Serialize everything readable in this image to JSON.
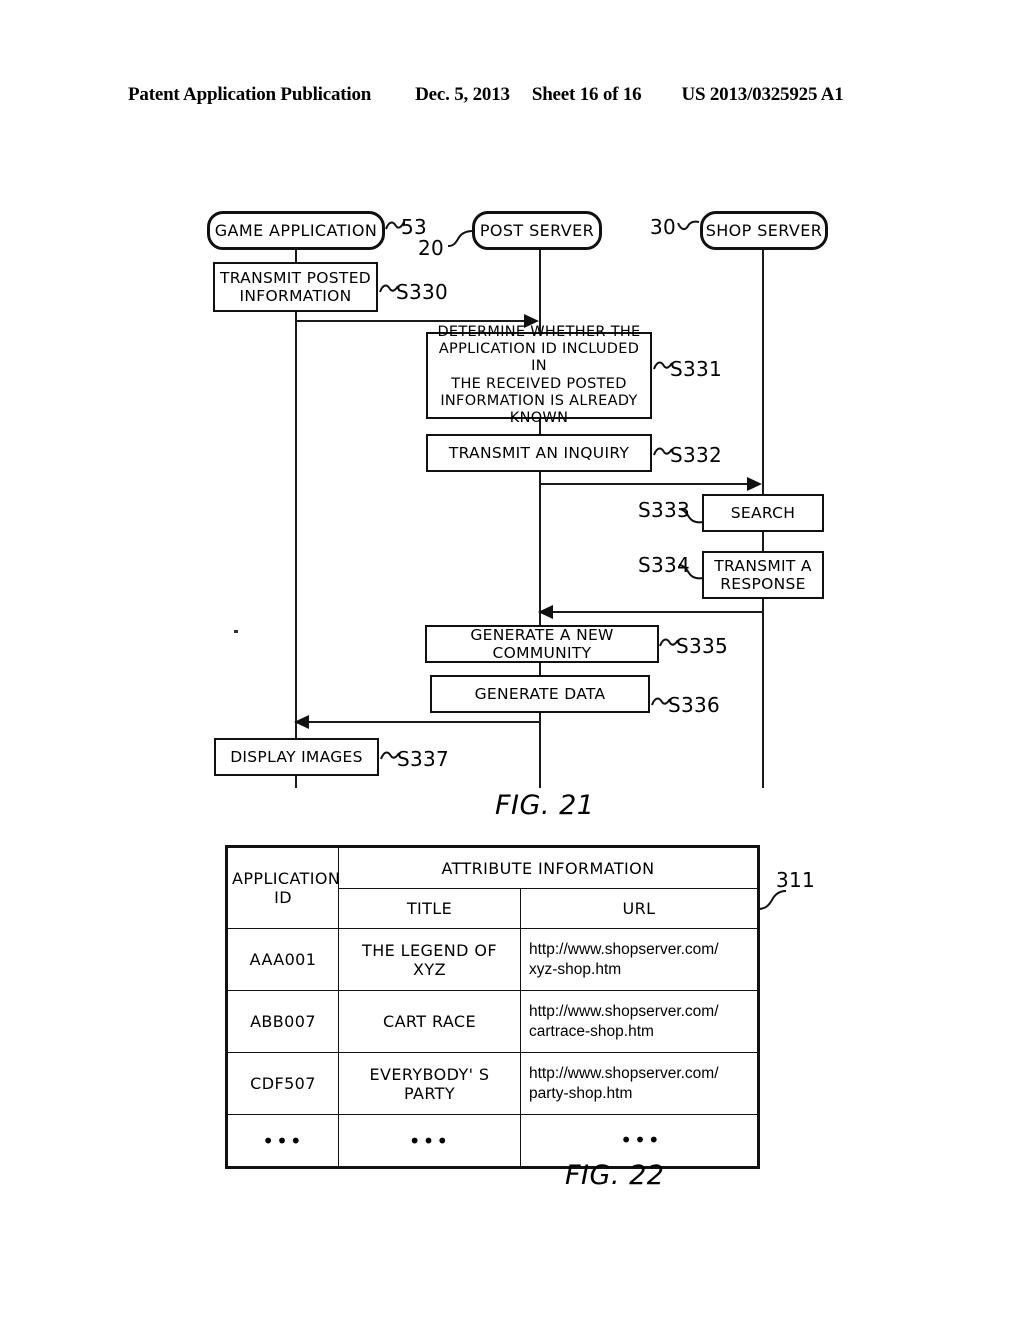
{
  "header": {
    "publication": "Patent Application Publication",
    "date": "Dec. 5, 2013",
    "sheet": "Sheet 16 of 16",
    "patent_number": "US 2013/0325925 A1"
  },
  "fig21": {
    "label": "FIG. 21",
    "actors": [
      {
        "name": "GAME APPLICATION",
        "ref": "53"
      },
      {
        "name": "POST SERVER",
        "ref": "20"
      },
      {
        "name": "SHOP SERVER",
        "ref": "30"
      }
    ],
    "steps": [
      {
        "id": "S330",
        "label": "TRANSMIT POSTED\nINFORMATION",
        "lane": "game-application"
      },
      {
        "id": "S331",
        "label": "DETERMINE WHETHER THE\nAPPLICATION ID INCLUDED IN\nTHE RECEIVED POSTED\nINFORMATION IS ALREADY KNOWN",
        "lane": "post-server"
      },
      {
        "id": "S332",
        "label": "TRANSMIT AN INQUIRY",
        "lane": "post-server"
      },
      {
        "id": "S333",
        "label": "SEARCH",
        "lane": "shop-server"
      },
      {
        "id": "S334",
        "label": "TRANSMIT A\nRESPONSE",
        "lane": "shop-server"
      },
      {
        "id": "S335",
        "label": "GENERATE A NEW COMMUNITY",
        "lane": "post-server"
      },
      {
        "id": "S336",
        "label": "GENERATE DATA",
        "lane": "post-server"
      },
      {
        "id": "S337",
        "label": "DISPLAY IMAGES",
        "lane": "game-application"
      }
    ],
    "step_labels": {
      "s330_box_l1": "TRANSMIT POSTED",
      "s330_box_l2": "INFORMATION",
      "s331_box_l1": "DETERMINE WHETHER THE",
      "s331_box_l2": "APPLICATION ID INCLUDED IN",
      "s331_box_l3": "THE RECEIVED POSTED",
      "s331_box_l4": "INFORMATION IS ALREADY KNOWN",
      "s332_box": "TRANSMIT AN INQUIRY",
      "s333_box": "SEARCH",
      "s334_box_l1": "TRANSMIT A",
      "s334_box_l2": "RESPONSE",
      "s335_box": "GENERATE A NEW COMMUNITY",
      "s336_box": "GENERATE DATA",
      "s337_box": "DISPLAY IMAGES"
    },
    "step_ids": {
      "s330": "S330",
      "s331": "S331",
      "s332": "S332",
      "s333": "S333",
      "s334": "S334",
      "s335": "S335",
      "s336": "S336",
      "s337": "S337"
    },
    "actor_labels": {
      "game_application": "GAME APPLICATION",
      "post_server": "POST SERVER",
      "shop_server": "SHOP SERVER"
    },
    "actor_refs": {
      "game_application": "53",
      "post_server": "20",
      "shop_server": "30"
    }
  },
  "fig22": {
    "label": "FIG. 22",
    "table_ref": "311",
    "headers": {
      "application_id": "APPLICATION\nID",
      "application_id_l1": "APPLICATION",
      "application_id_l2": "ID",
      "attribute_information": "ATTRIBUTE INFORMATION",
      "title": "TITLE",
      "url": "URL"
    },
    "rows": [
      {
        "application_id": "AAA001",
        "title": "THE LEGEND OF XYZ",
        "url_l1": "http://www.shopserver.com/",
        "url_l2": "xyz-shop.htm"
      },
      {
        "application_id": "ABB007",
        "title": "CART RACE",
        "url_l1": "http://www.shopserver.com/",
        "url_l2": "cartrace-shop.htm"
      },
      {
        "application_id": "CDF507",
        "title": "EVERYBODY' S PARTY",
        "url_l1": "http://www.shopserver.com/",
        "url_l2": "party-shop.htm"
      },
      {
        "application_id": "•••",
        "title": "•••",
        "url_l1": "•••",
        "url_l2": ""
      }
    ]
  },
  "colors": {
    "ink": "#111111",
    "paper": "#ffffff"
  }
}
